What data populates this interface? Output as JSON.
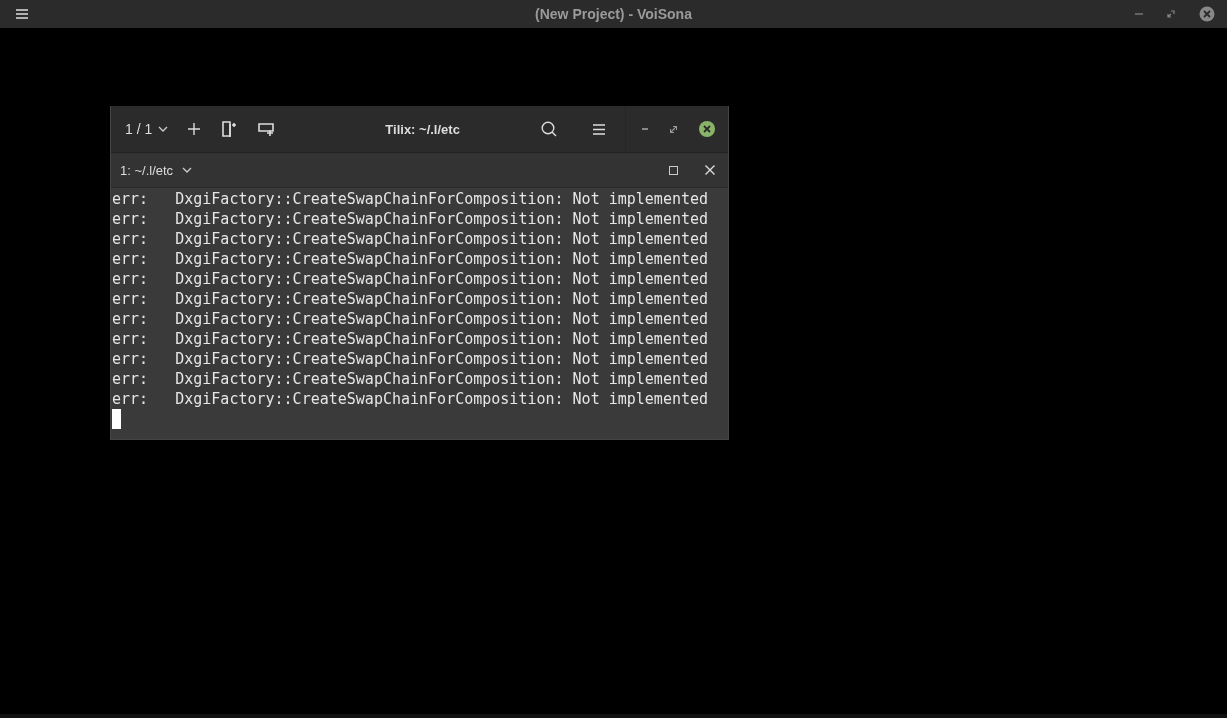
{
  "window": {
    "title": "(New Project) - VoiSona"
  },
  "terminal": {
    "session_selector": "1 / 1",
    "title": "Tilix: ~/.l/etc",
    "tab": {
      "label": "1: ~/.l/etc"
    },
    "lines": [
      "err:   DxgiFactory::CreateSwapChainForComposition: Not implemented",
      "err:   DxgiFactory::CreateSwapChainForComposition: Not implemented",
      "err:   DxgiFactory::CreateSwapChainForComposition: Not implemented",
      "err:   DxgiFactory::CreateSwapChainForComposition: Not implemented",
      "err:   DxgiFactory::CreateSwapChainForComposition: Not implemented",
      "err:   DxgiFactory::CreateSwapChainForComposition: Not implemented",
      "err:   DxgiFactory::CreateSwapChainForComposition: Not implemented",
      "err:   DxgiFactory::CreateSwapChainForComposition: Not implemented",
      "err:   DxgiFactory::CreateSwapChainForComposition: Not implemented",
      "err:   DxgiFactory::CreateSwapChainForComposition: Not implemented",
      "err:   DxgiFactory::CreateSwapChainForComposition: Not implemented"
    ]
  }
}
